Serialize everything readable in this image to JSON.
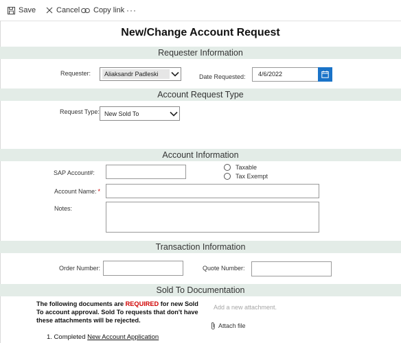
{
  "toolbar": {
    "save_label": "Save",
    "cancel_label": "Cancel",
    "copy_link_label": "Copy link",
    "more_label": "···"
  },
  "form": {
    "title": "New/Change Account Request",
    "sections": {
      "requester": "Requester Information",
      "account_request_type": "Account Request Type",
      "account_info": "Account Information",
      "transaction": "Transaction Information",
      "sold_to_docs": "Sold To Documentation"
    },
    "requester": {
      "label": "Requester:",
      "value": "Aliaksandr Padleski"
    },
    "date_requested": {
      "label": "Date Requested:",
      "value": "4/6/2022"
    },
    "request_type": {
      "label": "Request Type:",
      "value": "New Sold To"
    },
    "sap_account": {
      "label": "SAP Account#:",
      "value": ""
    },
    "tax_options": [
      "Taxable",
      "Tax Exempt"
    ],
    "account_name": {
      "label": "Account Name:",
      "required_mark": "*",
      "value": ""
    },
    "notes": {
      "label": "Notes:",
      "value": ""
    },
    "order_number": {
      "label": "Order Number:",
      "value": ""
    },
    "quote_number": {
      "label": "Quote Number:",
      "value": ""
    },
    "docs": {
      "intro_before": "The following documents are ",
      "intro_required": "REQUIRED",
      "intro_after": " for new Sold To account approval. Sold To requests that don't have these attachments will be rejected.",
      "item_1_prefix": "1. Completed ",
      "item_1_link": "New Account Application",
      "attachment_placeholder": "Add a new attachment.",
      "attach_file_label": "Attach file"
    }
  },
  "colors": {
    "section_band": "#e3ece7",
    "calendar_button": "#1a73c8",
    "required_text": "#d00000"
  }
}
